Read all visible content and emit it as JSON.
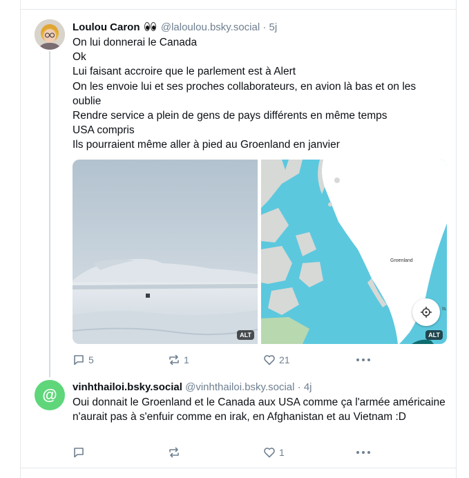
{
  "posts": [
    {
      "author": "Loulou Caron",
      "handle": "@laloulou.bsky.social",
      "time": "5j",
      "lines": [
        "On lui donnerai le Canada",
        "Ok",
        "Lui faisant accroire que le parlement est à Alert",
        "On les envoie lui et ses proches collaborateurs, en avion là bas et on les oublie",
        "Rendre service a plein de gens de pays différents en même temps",
        "USA compris",
        "Ils pourraient même aller à pied au Groenland en janvier"
      ],
      "images": [
        {
          "alt_badge": "ALT"
        },
        {
          "alt_badge": "ALT",
          "map_label": "Groenland",
          "map_edge_label": "Is"
        }
      ],
      "replies": "5",
      "reposts": "1",
      "likes": "21"
    },
    {
      "author": "vinhthailoi.bsky.social",
      "handle": "@vinhthailoi.bsky.social",
      "time": "4j",
      "avatar_symbol": "@",
      "text": "Oui donnait le Groenland et le Canada aux USA comme ça l'armée américaine n'aurait pas à s'enfuir comme en irak, en Afghanistan et au Vietnam :D",
      "replies": "",
      "reposts": "",
      "likes": "1"
    }
  ],
  "separator": "·",
  "icons": [
    "reply-icon",
    "repost-icon",
    "like-icon",
    "more-icon",
    "locate-icon",
    "eyes-emoji-icon"
  ],
  "colors": {
    "muted": "#6e7f8f",
    "divider": "#e4e8ec",
    "avatar2": "#5fd67a",
    "map_water": "#5cc8de"
  }
}
